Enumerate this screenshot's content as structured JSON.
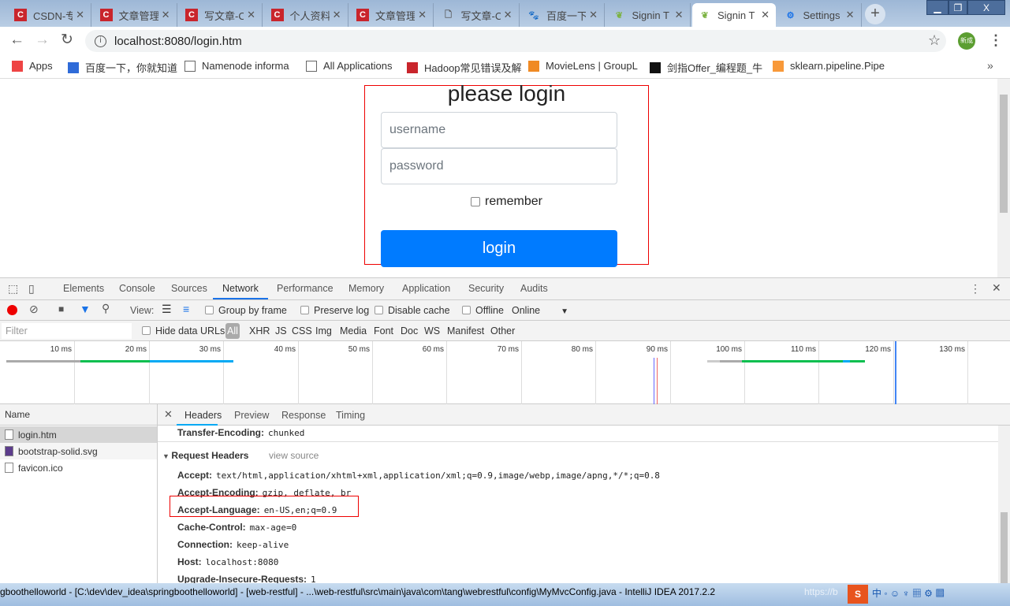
{
  "browser": {
    "tabs": [
      {
        "title": "CSDN-专",
        "icon": "csdn-icon",
        "active": false
      },
      {
        "title": "文章管理",
        "icon": "csdn-icon",
        "active": false
      },
      {
        "title": "写文章-C",
        "icon": "csdn-icon",
        "active": false
      },
      {
        "title": "个人资料",
        "icon": "csdn-icon",
        "active": false
      },
      {
        "title": "文章管理",
        "icon": "csdn-icon",
        "active": false
      },
      {
        "title": "写文章-C",
        "icon": "page-icon",
        "active": false
      },
      {
        "title": "百度一下",
        "icon": "baidu-icon",
        "active": false
      },
      {
        "title": "Signin T",
        "icon": "spring-leaf-icon",
        "active": false
      },
      {
        "title": "Signin T",
        "icon": "spring-leaf-icon",
        "active": true
      },
      {
        "title": "Settings",
        "icon": "gear-icon",
        "active": false
      }
    ],
    "url": "localhost:8080/login.htm",
    "profile_label": "新成",
    "bookmarks": [
      {
        "label": "Apps",
        "icon": "apps-grid-icon"
      },
      {
        "label": "百度一下，你就知道",
        "icon": "baidu-icon"
      },
      {
        "label": "Namenode informa",
        "icon": "page-icon"
      },
      {
        "label": "All Applications",
        "icon": "page-icon"
      },
      {
        "label": "Hadoop常见错误及解",
        "icon": "csdn-icon"
      },
      {
        "label": "MovieLens | GroupL",
        "icon": "grouplens-icon"
      },
      {
        "label": "剑指Offer_编程题_牛",
        "icon": "nowcoder-icon"
      },
      {
        "label": "sklearn.pipeline.Pipe",
        "icon": "sklearn-icon"
      }
    ]
  },
  "login": {
    "title": "please login",
    "username_placeholder": "username",
    "password_placeholder": "password",
    "remember_label": "remember",
    "remember_checked": false,
    "button_label": "login",
    "button_color": "#007bff"
  },
  "devtools": {
    "tabs": [
      "Elements",
      "Console",
      "Sources",
      "Network",
      "Performance",
      "Memory",
      "Application",
      "Security",
      "Audits"
    ],
    "active_tab": "Network",
    "toolbar": {
      "view_label": "View:",
      "group_by_frame": "Group by frame",
      "preserve_log": "Preserve log",
      "disable_cache": "Disable cache",
      "offline": "Offline",
      "throttle": "Online"
    },
    "filter": {
      "placeholder": "Filter",
      "hide_data_urls": "Hide data URLs",
      "types": [
        "All",
        "XHR",
        "JS",
        "CSS",
        "Img",
        "Media",
        "Font",
        "Doc",
        "WS",
        "Manifest",
        "Other"
      ],
      "active_type": "All"
    },
    "timeline_ticks": [
      "10 ms",
      "20 ms",
      "30 ms",
      "40 ms",
      "50 ms",
      "60 ms",
      "70 ms",
      "80 ms",
      "90 ms",
      "100 ms",
      "110 ms",
      "120 ms",
      "130 ms"
    ],
    "name_header": "Name",
    "requests": [
      {
        "name": "login.htm",
        "icon": "document-icon",
        "selected": true
      },
      {
        "name": "bootstrap-solid.svg",
        "icon": "image-icon",
        "selected": false
      },
      {
        "name": "favicon.ico",
        "icon": "file-icon",
        "selected": false
      }
    ],
    "detail_tabs": [
      "Headers",
      "Preview",
      "Response",
      "Timing"
    ],
    "active_detail_tab": "Headers",
    "transfer_encoding": {
      "key": "Transfer-Encoding:",
      "value": "chunked"
    },
    "request_headers_title": "Request Headers",
    "view_source": "view source",
    "request_headers": [
      {
        "key": "Accept:",
        "value": "text/html,application/xhtml+xml,application/xml;q=0.9,image/webp,image/apng,*/*;q=0.8"
      },
      {
        "key": "Accept-Encoding:",
        "value": "gzip, deflate, br"
      },
      {
        "key": "Accept-Language:",
        "value": "en-US,en;q=0.9",
        "highlighted": true
      },
      {
        "key": "Cache-Control:",
        "value": "max-age=0"
      },
      {
        "key": "Connection:",
        "value": "keep-alive"
      },
      {
        "key": "Host:",
        "value": "localhost:8080"
      },
      {
        "key": "Upgrade-Insecure-Requests:",
        "value": "1"
      }
    ]
  },
  "taskbar": {
    "window_title": "gboothelloworld - [C:\\dev\\dev_idea\\springboothelloworld] - [web-restful] - ...\\web-restful\\src\\main\\java\\com\\tang\\webrestful\\config\\MyMvcConfig.java - IntelliJ IDEA 2017.2.2",
    "watermark": "https://b"
  }
}
